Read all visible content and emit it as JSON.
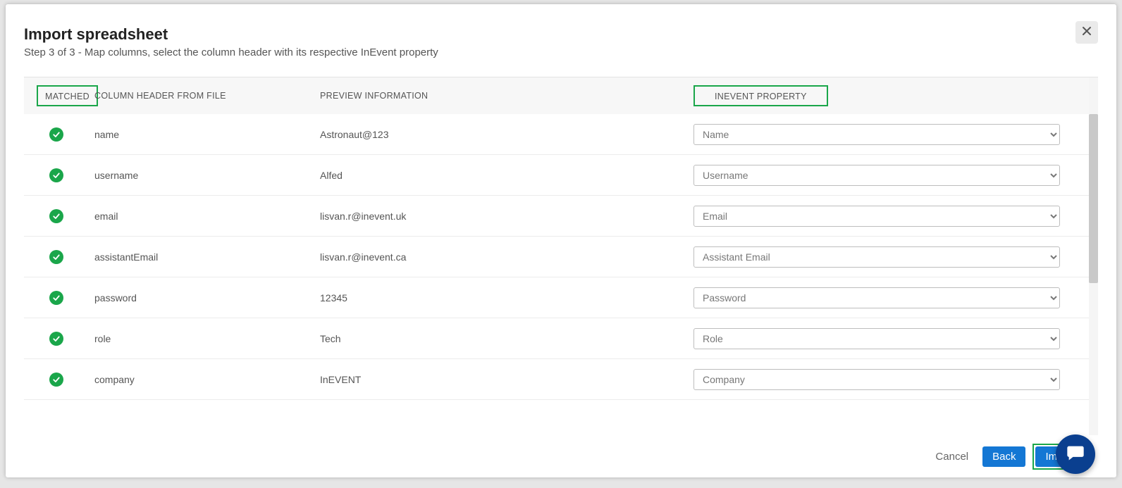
{
  "modal": {
    "title": "Import spreadsheet",
    "subtitle": "Step 3 of 3 - Map columns, select the column header with its respective InEvent property"
  },
  "headers": {
    "matched": "MATCHED",
    "column": "COLUMN HEADER FROM FILE",
    "preview": "PREVIEW INFORMATION",
    "property": "INEVENT PROPERTY"
  },
  "rows": [
    {
      "column": "name",
      "preview": "Astronaut@123",
      "property": "Name"
    },
    {
      "column": "username",
      "preview": "Alfed",
      "property": "Username"
    },
    {
      "column": "email",
      "preview": "lisvan.r@inevent.uk",
      "property": "Email"
    },
    {
      "column": "assistantEmail",
      "preview": "lisvan.r@inevent.ca",
      "property": "Assistant Email"
    },
    {
      "column": "password",
      "preview": "12345",
      "property": "Password"
    },
    {
      "column": "role",
      "preview": "Tech",
      "property": "Role"
    },
    {
      "column": "company",
      "preview": "InEVENT",
      "property": "Company"
    }
  ],
  "footer": {
    "cancel": "Cancel",
    "back": "Back",
    "import": "Import"
  }
}
